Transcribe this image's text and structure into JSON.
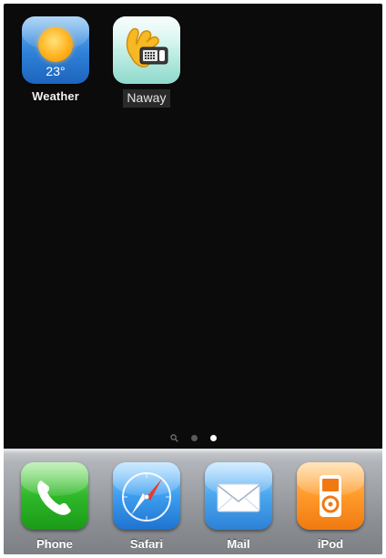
{
  "home_screen": {
    "apps": [
      {
        "label": "Weather",
        "temperature": "23°",
        "icon": "weather-sun-icon"
      },
      {
        "label": "Naway",
        "icon": "naway-hand-phone-icon"
      }
    ]
  },
  "page_indicator": {
    "search_icon": "search-icon",
    "total_pages": 2,
    "current_page": 2
  },
  "dock": {
    "items": [
      {
        "label": "Phone",
        "icon": "phone-handset-icon",
        "color": "#2fb82a"
      },
      {
        "label": "Safari",
        "icon": "compass-icon",
        "color": "#3d9ef0"
      },
      {
        "label": "Mail",
        "icon": "envelope-icon",
        "color": "#4aa6ee"
      },
      {
        "label": "iPod",
        "icon": "ipod-icon",
        "color": "#ff9a2a"
      }
    ]
  }
}
